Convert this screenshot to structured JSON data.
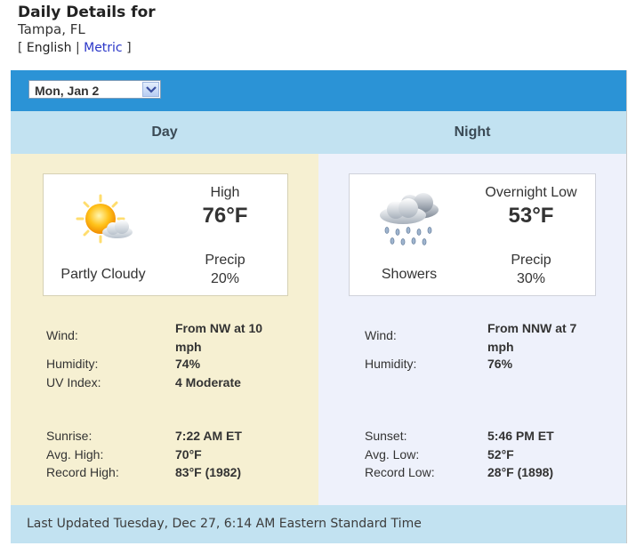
{
  "header": {
    "title": "Daily Details for",
    "location": "Tampa, FL",
    "units_open": "[",
    "units_english": "English",
    "units_sep": "|",
    "units_metric": "Metric",
    "units_close": "]"
  },
  "date_select": {
    "value": "Mon, Jan 2"
  },
  "columns": {
    "day": "Day",
    "night": "Night"
  },
  "day": {
    "icon": "partly-cloudy-icon",
    "condition": "Partly Cloudy",
    "temp_label": "High",
    "temp": "76°F",
    "precip_label": "Precip",
    "precip": "20%",
    "wind_label": "Wind:",
    "wind": "From NW at 10 mph",
    "humidity_label": "Humidity:",
    "humidity": "74%",
    "uv_label": "UV Index:",
    "uv": "4 Moderate",
    "sun_label": "Sunrise:",
    "sun": "7:22 AM ET",
    "avg_label": "Avg. High:",
    "avg": "70°F",
    "record_label": "Record High:",
    "record": "83°F (1982)"
  },
  "night": {
    "icon": "showers-icon",
    "condition": "Showers",
    "temp_label": "Overnight Low",
    "temp": "53°F",
    "precip_label": "Precip",
    "precip": "30%",
    "wind_label": "Wind:",
    "wind": "From NNW at 7 mph",
    "humidity_label": "Humidity:",
    "humidity": "76%",
    "sun_label": "Sunset:",
    "sun": "5:46 PM ET",
    "avg_label": "Avg. Low:",
    "avg": "52°F",
    "record_label": "Record Low:",
    "record": "28°F (1898)"
  },
  "footer": {
    "updated": "Last Updated Tuesday, Dec 27, 6:14 AM Eastern Standard Time"
  },
  "colors": {
    "accent": "#2b93d6",
    "header_band": "#c2e2f1",
    "day_bg": "#f6f0d2",
    "night_bg": "#eef1fb",
    "link": "#2a36c8"
  }
}
